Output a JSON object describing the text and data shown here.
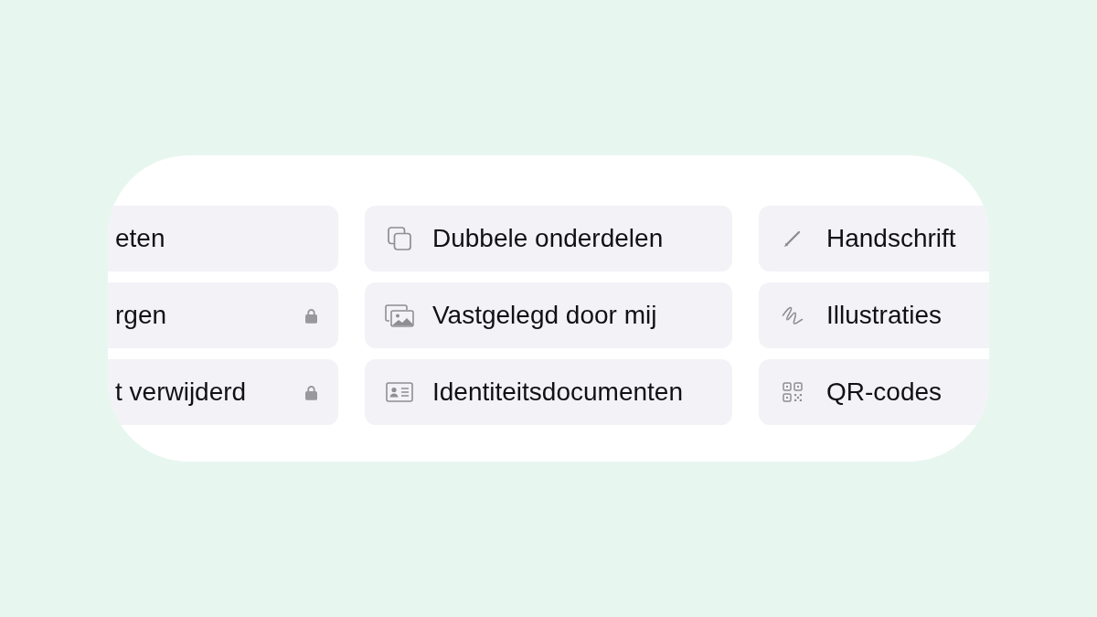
{
  "collections": {
    "columns": [
      {
        "items": [
          {
            "label": "eten",
            "locked": false
          },
          {
            "label": "rgen",
            "locked": true
          },
          {
            "label": "t verwijderd",
            "locked": true
          }
        ]
      },
      {
        "items": [
          {
            "label": "Dubbele onderdelen",
            "locked": false
          },
          {
            "label": "Vastgelegd door mij",
            "locked": false
          },
          {
            "label": "Identiteitsdocumenten",
            "locked": false
          }
        ]
      },
      {
        "items": [
          {
            "label": "Handschrift",
            "locked": false
          },
          {
            "label": "Illustraties",
            "locked": false
          },
          {
            "label": "QR-codes",
            "locked": false
          }
        ]
      }
    ]
  }
}
